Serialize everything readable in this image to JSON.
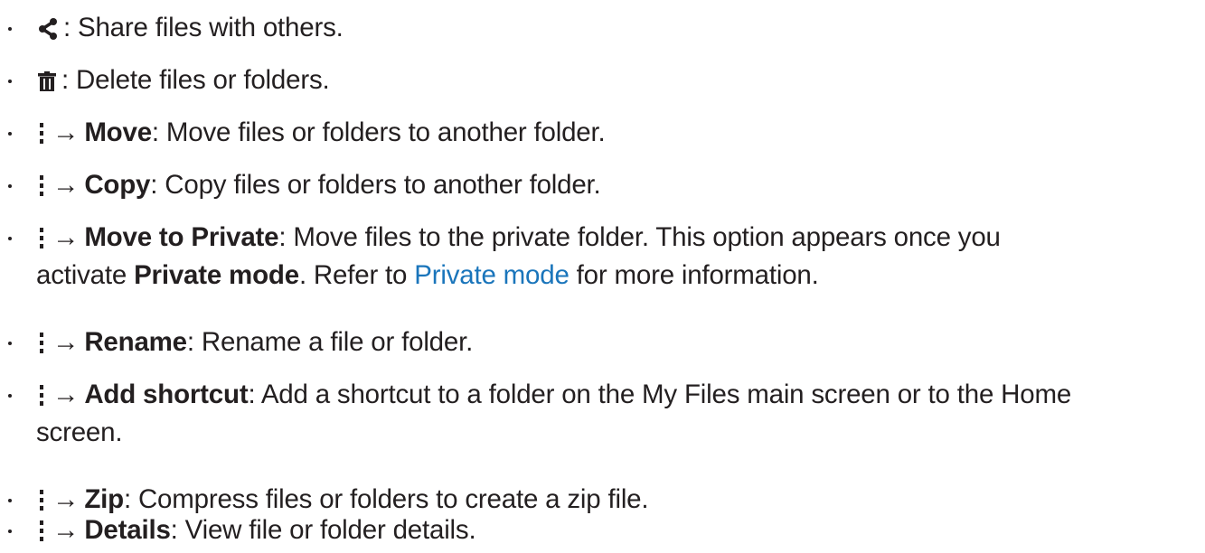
{
  "items": [
    {
      "icon": "share-icon",
      "sep": ": ",
      "bold": "",
      "text": "Share files with others."
    },
    {
      "icon": "trash-icon",
      "sep": ": ",
      "bold": "",
      "text": "Delete files or folders."
    },
    {
      "icon": "more-options-icon",
      "arrow": "→",
      "bold": "Move",
      "text": ": Move files or folders to another folder."
    },
    {
      "icon": "more-options-icon",
      "arrow": "→",
      "bold": "Copy",
      "text": ": Copy files or folders to another folder."
    },
    {
      "icon": "more-options-icon",
      "arrow": "→",
      "bold": "Move to Private",
      "text": ": Move files to the private folder. This option appears once you",
      "line2_prefix": "activate ",
      "line2_bold": "Private mode",
      "line2_mid": ". Refer to ",
      "line2_link": "Private mode",
      "line2_suffix": " for more information."
    },
    {
      "icon": "more-options-icon",
      "arrow": "→",
      "bold": "Rename",
      "text": ": Rename a file or folder."
    },
    {
      "icon": "more-options-icon",
      "arrow": "→",
      "bold": "Add shortcut",
      "text": ": Add a shortcut to a folder on the My Files main screen or to the Home",
      "line2_text": "screen."
    },
    {
      "icon": "more-options-icon",
      "arrow": "→",
      "bold": "Zip",
      "text": ": Compress files or folders to create a zip file."
    },
    {
      "icon": "more-options-icon",
      "arrow": "→",
      "bold": "Details",
      "text": ": View file or folder details."
    }
  ],
  "colors": {
    "text": "#231f20",
    "link": "#1a75bb"
  }
}
